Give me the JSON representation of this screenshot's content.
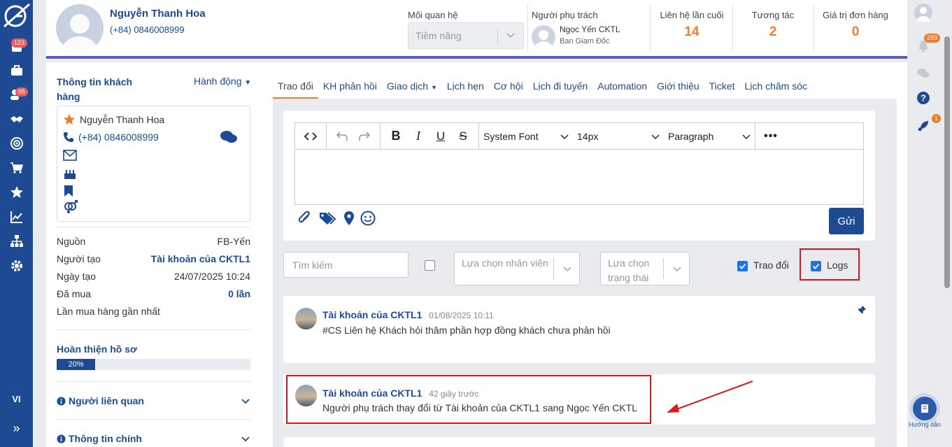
{
  "left_nav": {
    "badge_notifications": "123",
    "badge_customers": "95",
    "language": "VI"
  },
  "header": {
    "customer_name": "Nguyễn Thanh Hoa",
    "customer_phone": "(+84) 0846008999",
    "relation_label": "Mối quan hệ",
    "relation_value": "Tiềm năng",
    "owner_label": "Người phụ trách",
    "owner_name": "Ngọc Yến CKTL",
    "owner_role": "Ban Giam Đốc",
    "last_contact_label": "Liên hệ lần cuối",
    "last_contact_value": "14",
    "interaction_label": "Tương tác",
    "interaction_value": "2",
    "order_value_label": "Giá trị đơn hàng",
    "order_value_value": "0"
  },
  "right_nav": {
    "badge_bell": "293",
    "badge_rocket": "1",
    "guide_label": "Hướng dẫn"
  },
  "left_panel": {
    "title": "Thông tin khách hàng",
    "action": "Hành động",
    "contact_name": "Nguyễn Thanh Hoa",
    "contact_phone": "(+84) 0846008999",
    "rows": [
      {
        "label": "Nguồn",
        "value": "FB-Yến"
      },
      {
        "label": "Người tạo",
        "value": "Tài khoản của CKTL1"
      },
      {
        "label": "Ngày tạo",
        "value": "24/07/2025 10:24"
      },
      {
        "label": "Đã mua",
        "value": "0 lần"
      },
      {
        "label": "Lần mua hàng gần nhất",
        "value": ""
      }
    ],
    "profile_label": "Hoàn thiện hồ sơ",
    "profile_percent": "20%",
    "profile_fraction": 0.2,
    "related_label": "Người liên quan",
    "main_info_label": "Thông tin chính"
  },
  "tabs": [
    "Trao đổi",
    "KH phản hồi",
    "Giao dịch",
    "Lịch hẹn",
    "Cơ hội",
    "Lịch đi tuyến",
    "Automation",
    "Giới thiệu",
    "Ticket",
    "Lịch chăm sóc"
  ],
  "editor": {
    "font": "System Font",
    "size": "14px",
    "block": "Paragraph",
    "send": "Gửi"
  },
  "filters": {
    "search_placeholder": "Tìm kiếm",
    "staff_placeholder": "Lựa chọn nhân viên",
    "status_placeholder": "Lựa chọn trạng thái",
    "exchange_label": "Trao đổi",
    "logs_label": "Logs"
  },
  "feed": [
    {
      "author": "Tài khoản của CKTL1",
      "time": "01/08/2025 10:11",
      "text": "#CS Liên hệ Khách hỏi thăm phần hợp đồng khách chưa phản hồi"
    },
    {
      "author": "Tài khoản của CKTL1",
      "time": "42 giây trước",
      "text": "Người phụ trách thay đổi từ Tài khoản của CKTL1 sang Ngọc Yến CKTL"
    }
  ],
  "colors": {
    "brand": "#1d4a93",
    "accent": "#f07c2d",
    "highlight": "#e0161e"
  }
}
